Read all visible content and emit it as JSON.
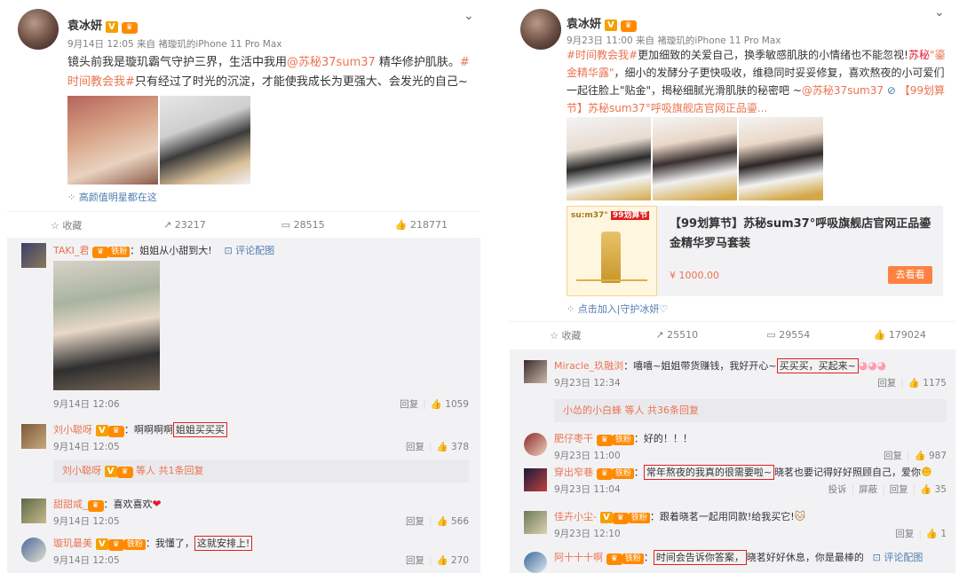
{
  "left": {
    "post": {
      "author": "袁冰妍",
      "meta": "9月14日 12:05 来自 褚璇玑的iPhone 11 Pro Max",
      "text_part1": "镜头前我是璇玑霸气守护三界，生活中我用",
      "text_link1": "@苏秘37sum37",
      "text_part2": " 精华修护肌肤。",
      "text_tag": "#时间教会我#",
      "text_part3": "只有经过了时光的沉淀，才能使我成长为更强大、会发光的自己~",
      "extra_link": "高颜值明星都在这",
      "actions": {
        "favorite": "收藏",
        "repost": "23217",
        "comment": "28515",
        "like": "218771"
      }
    },
    "comments": [
      {
        "name": "TAKI_君",
        "text": "：姐姐从小甜到大!",
        "pic_label": "评论配图",
        "time": "9月14日 12:06",
        "reply": "回复",
        "likes": "1059"
      },
      {
        "name": "刘小聪呀",
        "text_plain": "：啊啊啊啊",
        "text_hl": "姐姐买买买",
        "time": "9月14日 12:05",
        "reply": "回复",
        "likes": "378",
        "sub": "刘小聪呀",
        "sub_tail": "等人 共1条回复"
      },
      {
        "name": "甜甜咸_",
        "text": "：喜欢喜欢",
        "time": "9月14日 12:05",
        "reply": "回复",
        "likes": "566"
      },
      {
        "name": "璇玑最美",
        "text_plain": "：我懂了，",
        "text_hl": "这就安排上!",
        "time": "9月14日 12:05",
        "reply": "回复",
        "likes": "270"
      }
    ],
    "fan_badge": "铁粉"
  },
  "right": {
    "post": {
      "author": "袁冰妍",
      "meta": "9月23日 11:00 来自 褚璇玑的iPhone 11 Pro Max",
      "text_tag": "#时间教会我#",
      "text_part1": "更加细致的关爱自己，换季敏感肌肤的小情绪也不能忽视!",
      "text_red": "苏秘",
      "text_link_q": "\"鎏金精华露\"",
      "text_part2": "，细小的发酵分子更快吸收，维稳同时妥妥修复，喜欢熬夜的小可爱们一起往脸上\"贴金\"，揭秘细腻光滑肌肤的秘密吧 ~",
      "text_link1": "@苏秘37sum37",
      "text_link2": "【99划算节】苏秘sum37°呼吸旗舰店官网正品鎏...",
      "product": {
        "title": "【99划算节】苏秘sum37°呼吸旗舰店官网正品鎏金精华罗马套装",
        "price": "¥ 1000.00",
        "button": "去看看",
        "thumb_brand": "su:m37°",
        "thumb_badge": "99划算节"
      },
      "extra_link": "点击加入|守护冰妍♡",
      "actions": {
        "favorite": "收藏",
        "repost": "25510",
        "comment": "29554",
        "like": "179024"
      }
    },
    "comments": [
      {
        "name": "Miracle_玖融浏",
        "text_plain": "：嘻嘻~姐姐带货赚钱，我好开心~",
        "text_hl": "买买买，买起来~",
        "time": "9月23日 12:34",
        "reply": "回复",
        "likes": "1175",
        "sub": "小怂的小白蜂",
        "sub_tail": "等人 共36条回复"
      },
      {
        "name": "肥仔枣干",
        "text": "：好的！！！",
        "time": "9月23日 11:00",
        "reply": "回复",
        "likes": "987"
      },
      {
        "name": "穿出窄巷",
        "text_hl": "常年熬夜的我真的很需要啦~",
        "text_plain": "晓茗也要记得好好照顾自己，爱你",
        "time": "9月23日 11:04",
        "report": "投诉",
        "block": "屏蔽",
        "reply": "回复",
        "likes": "35"
      },
      {
        "name": "佳卉小尘-",
        "text": "：跟着晓茗一起用同款!给我买它!",
        "time": "9月23日 12:10",
        "reply": "回复",
        "likes": "1"
      },
      {
        "name": "阿十十十啊",
        "text_hl": "时间会告诉你答案，",
        "text_plain": "晓茗好好休息，你是最棒的",
        "pic_label": "评论配图"
      }
    ],
    "fan_badge": "铁粉"
  },
  "icons": {
    "star": "☆",
    "repost": "↗",
    "comment": "▭",
    "like": "👍",
    "chevron": "⌄",
    "link": "⊘"
  }
}
